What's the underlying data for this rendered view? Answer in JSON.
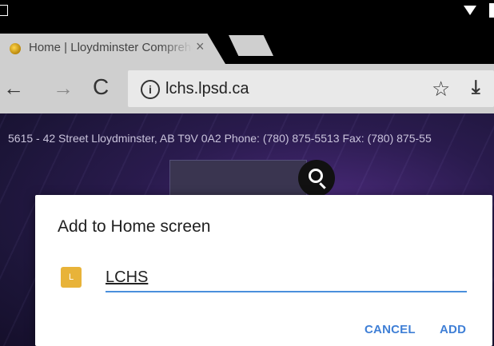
{
  "tabs": {
    "active_title": "Home | Lloydminster Comprehensive High School",
    "close_glyph": "×"
  },
  "toolbar": {
    "back_glyph": "←",
    "forward_glyph": "→",
    "reload_glyph": "C",
    "info_glyph": "i",
    "url": "lchs.lpsd.ca",
    "bookmark_glyph": "☆",
    "download_glyph": "⤓"
  },
  "page": {
    "address_line": "5615 - 42 Street Lloydminster, AB T9V 0A2 Phone: (780) 875-5513 Fax: (780) 875-55"
  },
  "dialog": {
    "title": "Add to Home screen",
    "icon_letter": "L",
    "name_value": "LCHS",
    "cancel_label": "CANCEL",
    "add_label": "ADD"
  },
  "colors": {
    "accent": "#3f7fd6",
    "icon_bg": "#e8b339",
    "page_bg": "#2a1b4e"
  }
}
